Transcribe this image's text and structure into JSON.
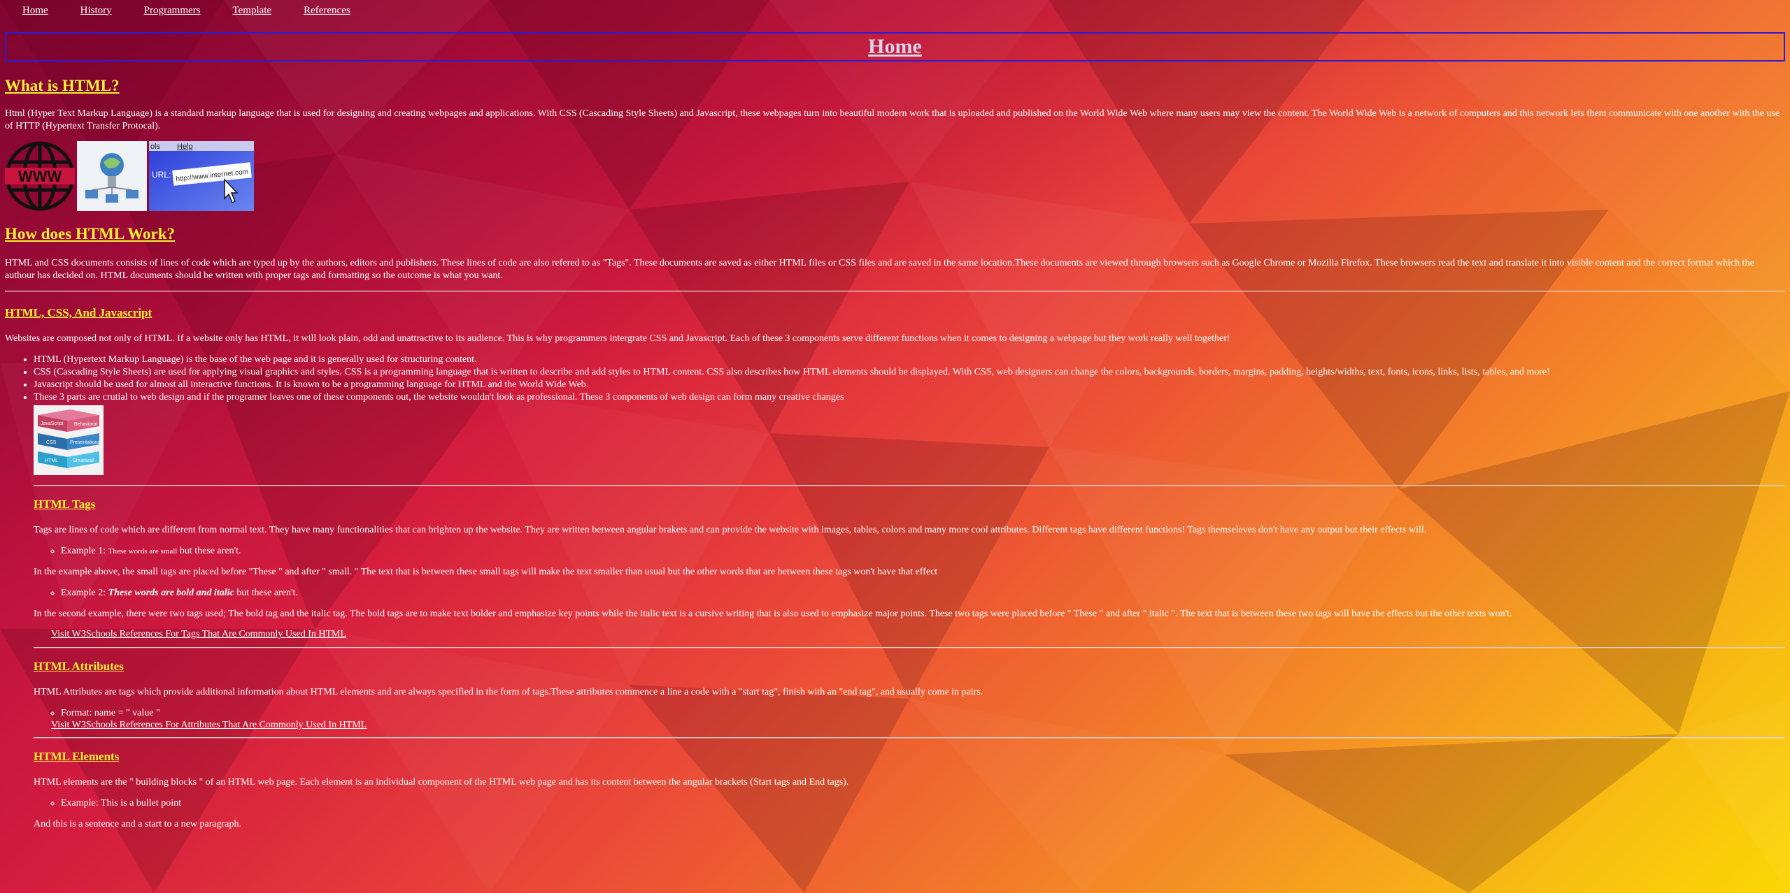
{
  "nav": {
    "items": [
      "Home",
      "History",
      "Programmers",
      "Template",
      "References"
    ]
  },
  "header": {
    "title": "Home"
  },
  "section_html": {
    "heading": "What is HTML?",
    "paragraph": "Html (Hyper Text Markup Language) is a standard markup language that is used for designing and creating webpages and applications. With CSS (Cascading Style Sheets) and Javascript, these webpages turn into beautiful modern work that is uploaded and published on the World Wide Web where many users may view the content. The World Wide Web is a network of computers and this network lets them communicate with one another with the use of HTTP (Hypertext Transfer Protocal).",
    "images": [
      "www-globe-icon",
      "network-computers-image",
      "browser-url-image"
    ],
    "url_text": "http://www.internet.com",
    "url_label": "URL:",
    "menu_tools": "ols",
    "menu_help": "Help"
  },
  "section_work": {
    "heading": "How does HTML Work?",
    "paragraph": "HTML and CSS documents consists of lines of code which are typed up by the authors, editors and publishers. These lines of code are also refered to as \"Tags\". These documents are saved as either HTML files or CSS files and are saved in the same location.These documents are viewed through browsers such as Google Chrome or Mozilla Firefox. These browsers read the text and translate it into visible content and the correct format which the authour has decided on. HTML documents should be written with proper tags and formatting so the outcome is what you want."
  },
  "section_trio": {
    "heading": "HTML, CSS, And Javascript",
    "paragraph": "Websites are composed not only of HTML. If a website only has HTML, it will look plain, odd and unattractive to its audience. This is why programmers intergrate CSS and Javascript. Each of these 3 components serve different functions when it comes to designing a webpage but they work really well together!",
    "bullets": [
      "HTML (Hypertext Markup Language) is the base of the web page and it is generally used for structuring content.",
      "CSS (Cascading Style Sheets) are used for applying visual graphics and styles. CSS is a programming language that is written to describe and add styles to HTML content. CSS also describes how HTML elements should be displayed. With CSS, web designers can change the colors, backgrounds, borders, margins, padding, heights/widths, text, fonts, icons, links, lists, tables, and more!",
      "Javascript should be used for almost all interactive functions. It is known to be a programming language for HTML and the World Wide Web.",
      "These 3 parts are crutial to web design and if the programer leaves one of these components out, the website wouldn't look as professional. These 3 conponents of web design can form many creative changes"
    ],
    "stack_image": {
      "layers": [
        {
          "left": "JavaScript",
          "right": "Behavioral"
        },
        {
          "left": "CSS",
          "right": "Presentational"
        },
        {
          "left": "HTML",
          "right": "Structural"
        }
      ]
    }
  },
  "section_tags": {
    "heading": "HTML Tags",
    "paragraph": "Tags are lines of code which are different from normal text. They have many functionalities that can brighten up the website. They are written between angular brakets and can provide the website with images, tables, colors and many more cool attributes. Different tags have different functions! Tags themseleves don't have any output but their effects will.",
    "example1_prefix": "Example 1: ",
    "example1_small": "These words are small",
    "example1_suffix": " but these aren't.",
    "explain1": "In the example above, the small tags are placed before \"These \" and after \" small. \" The text that is between these small tags will make the text smaller than usual but the other words that are between these tags won't have that effect",
    "example2_prefix": "Example 2: ",
    "example2_bi": "These words are bold and italic",
    "example2_suffix": " but these aren't.",
    "explain2": "In the second example, there were two tags used; The bold tag and the italic tag. The bold tags are to make text bolder and emphasize key points while the italic text is a cursive writing that is also used to emphasize major points. These two tags were placed before \" These \" and after \" italic \". The text that is between these two tags will have the effects but the other texts won't.",
    "link": "Visit W3Schools References For Tags That Are Commonly Used In HTML"
  },
  "section_attr": {
    "heading": "HTML Attributes",
    "paragraph": "HTML Attributes are tags which provide additional information about HTML elements and are always specified in the form of tags.These attributes commence a line a code with a \"start tag\", finish with an \"end tag\", and usually come in pairs.",
    "format": "Format: name = \" value \"",
    "link": "Visit W3Schools References For Attributes That Are Commonly Used In HTML"
  },
  "section_elem": {
    "heading": "HTML Elements",
    "paragraph": "HTML elements are the \" building blocks \" of an HTML web page. Each element is an individual component of the HTML web page and has its content between the angular brackets (Start tags and End tags).",
    "example": "Example: This is a bullet point",
    "closing": "And this is a sentence and a start to a new paragraph."
  }
}
